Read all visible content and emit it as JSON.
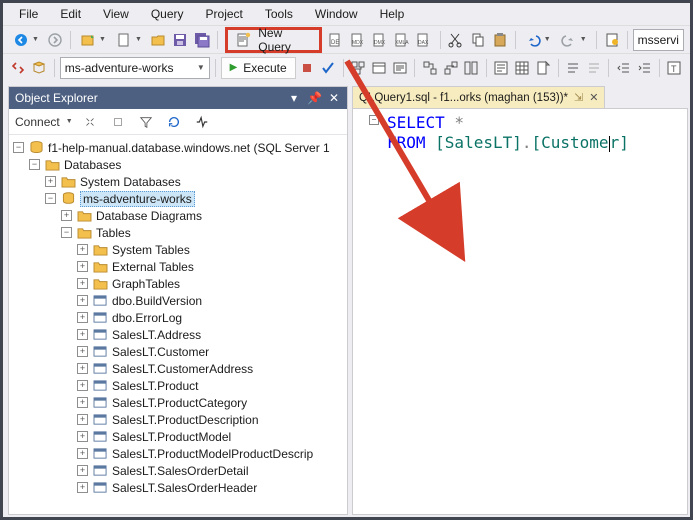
{
  "menu": {
    "items": [
      "File",
      "Edit",
      "View",
      "Query",
      "Project",
      "Tools",
      "Window",
      "Help"
    ]
  },
  "toolbar1": {
    "new_query_label": "New Query",
    "right_combo_value": "msservi"
  },
  "toolbar2": {
    "db_combo_value": "ms-adventure-works",
    "execute_label": "Execute"
  },
  "object_explorer": {
    "title": "Object Explorer",
    "connect_label": "Connect",
    "tree": {
      "server": "f1-help-manual.database.windows.net (SQL Server 1",
      "databases": "Databases",
      "sys_db": "System Databases",
      "user_db": "ms-adventure-works",
      "diagrams": "Database Diagrams",
      "tables": "Tables",
      "systables": "System Tables",
      "exttables": "External Tables",
      "graphtables": "GraphTables",
      "t0": "dbo.BuildVersion",
      "t1": "dbo.ErrorLog",
      "t2": "SalesLT.Address",
      "t3": "SalesLT.Customer",
      "t4": "SalesLT.CustomerAddress",
      "t5": "SalesLT.Product",
      "t6": "SalesLT.ProductCategory",
      "t7": "SalesLT.ProductDescription",
      "t8": "SalesLT.ProductModel",
      "t9": "SalesLT.ProductModelProductDescrip",
      "t10": "SalesLT.SalesOrderDetail",
      "t11": "SalesLT.SalesOrderHeader"
    }
  },
  "editor": {
    "tab_label": "QLQuery1.sql - f1...orks (maghan (153))*",
    "code": {
      "kw_select": "SELECT",
      "star": " *",
      "kw_from": "FROM",
      "obj1": " [SalesLT]",
      "dot": ".",
      "obj2a": "[Custome",
      "obj2b": "r]"
    }
  }
}
